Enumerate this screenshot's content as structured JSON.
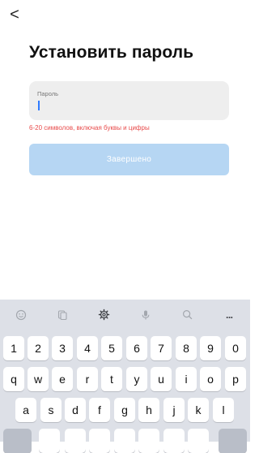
{
  "back_glyph": "<",
  "title": "Установить пароль",
  "password_field": {
    "label": "Пароль",
    "value": ""
  },
  "hint": "6-20 символов, включая буквы и цифры",
  "submit_label": "Завершено",
  "colors": {
    "accent": "#2f7bff",
    "submit_disabled": "#b6d6f3",
    "hint_red": "#e84b4b",
    "field_bg": "#eeeeee",
    "keyboard_bg": "#dde0e7"
  },
  "keyboard": {
    "toolbar": [
      {
        "icon": "emoji-icon"
      },
      {
        "icon": "clipboard-icon"
      },
      {
        "icon": "settings-gear-icon"
      },
      {
        "icon": "microphone-icon"
      },
      {
        "icon": "search-icon"
      },
      {
        "icon": "more-icon",
        "glyph": "..."
      }
    ],
    "row_numbers": [
      "1",
      "2",
      "3",
      "4",
      "5",
      "6",
      "7",
      "8",
      "9",
      "0"
    ],
    "row_1": [
      "q",
      "w",
      "e",
      "r",
      "t",
      "y",
      "u",
      "i",
      "o",
      "p"
    ],
    "row_2": [
      "a",
      "s",
      "d",
      "f",
      "g",
      "h",
      "j",
      "k",
      "l"
    ]
  }
}
